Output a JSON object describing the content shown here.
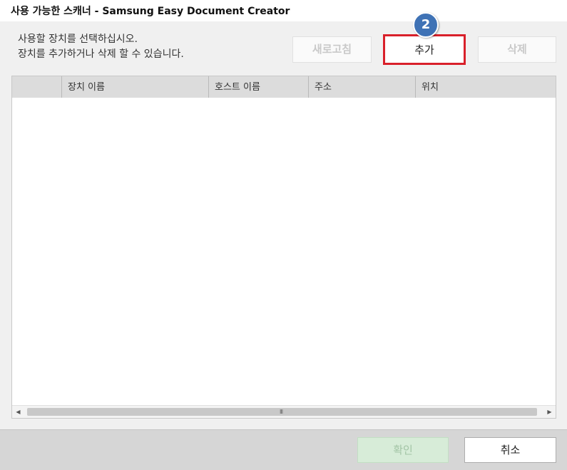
{
  "window": {
    "title": "사용 가능한 스캐너 - Samsung Easy Document Creator"
  },
  "instructions": {
    "line1": "사용할 장치를 선택하십시오.",
    "line2": "장치를 추가하거나 삭제 할 수 있습니다."
  },
  "toolbar": {
    "refresh_label": "새로고침",
    "add_label": "추가",
    "delete_label": "삭제",
    "step_badge": "2"
  },
  "device_list": {
    "columns": [
      "",
      "장치 이름",
      "호스트 이름",
      "주소",
      "위치"
    ],
    "rows": [],
    "scrollbar_grip": "III"
  },
  "footer": {
    "ok_label": "확인",
    "cancel_label": "취소"
  },
  "colors": {
    "highlight": "#d9202a",
    "badge": "#3f72b5",
    "ok_disabled": "#d7ecd8"
  }
}
